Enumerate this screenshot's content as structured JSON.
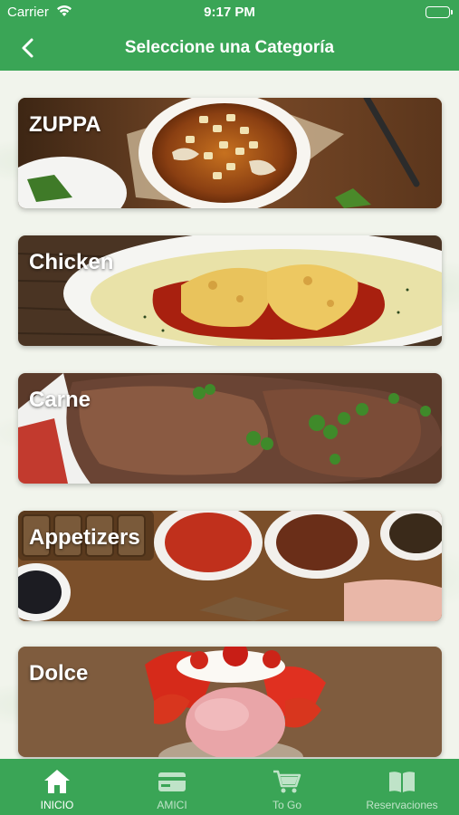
{
  "status_bar": {
    "carrier": "Carrier",
    "time": "9:17 PM",
    "icons": [
      "wifi-icon",
      "battery-icon"
    ]
  },
  "nav": {
    "back_icon": "chevron-left-icon",
    "title": "Seleccione una Categoría"
  },
  "categories": [
    {
      "label": "ZUPPA"
    },
    {
      "label": "Chicken"
    },
    {
      "label": "Carne"
    },
    {
      "label": "Appetizers"
    },
    {
      "label": "Dolce"
    }
  ],
  "tab_bar": {
    "active_color": "#ffffff",
    "inactive_color": "#bfe3c8",
    "background": "#3aa556",
    "tabs": [
      {
        "label": "INICIO",
        "icon": "home-icon",
        "active": true
      },
      {
        "label": "AMICI",
        "icon": "card-icon",
        "active": false
      },
      {
        "label": "To Go",
        "icon": "cart-icon",
        "active": false
      },
      {
        "label": "Reservaciones",
        "icon": "book-icon",
        "active": false
      }
    ]
  }
}
